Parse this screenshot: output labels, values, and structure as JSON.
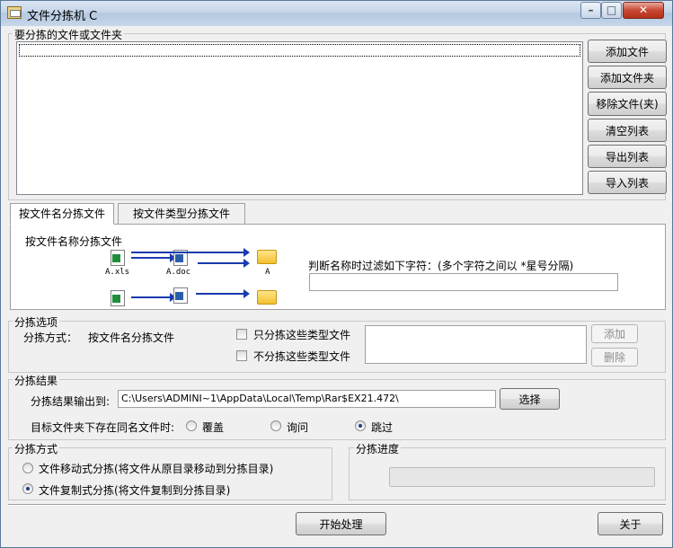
{
  "window": {
    "title": "文件分拣机 C",
    "min": "–",
    "max": "□",
    "close": "✕"
  },
  "files_group": {
    "label": "要分拣的文件或文件夹",
    "buttons": [
      "添加文件",
      "添加文件夹",
      "移除文件(夹)",
      "清空列表",
      "导出列表",
      "导入列表"
    ]
  },
  "tabs": [
    "按文件名分拣文件",
    "按文件类型分拣文件"
  ],
  "tab_panel": {
    "heading": "按文件名称分拣文件",
    "illustration": {
      "row1": [
        "A.xls",
        "A.doc",
        "A"
      ],
      "icons": [
        "excel-file-icon",
        "word-file-icon",
        "folder-icon"
      ]
    },
    "filter_label": "判断名称时过滤如下字符：(多个字符之间以 *星号分隔)",
    "filter_value": ""
  },
  "options": {
    "label": "分拣选项",
    "mode_label": "分拣方式：",
    "mode_value": "按文件名分拣文件",
    "only_types_label": "只分拣这些类型文件",
    "exclude_types_label": "不分拣这些类型文件",
    "add_button": "添加",
    "delete_button": "删除"
  },
  "result": {
    "label": "分拣结果",
    "output_label": "分拣结果输出到:",
    "output_path": "C:\\Users\\ADMINI~1\\AppData\\Local\\Temp\\Rar$EX21.472\\",
    "choose_button": "选择",
    "conflict_label": "目标文件夹下存在同名文件时:",
    "conflict_options": [
      "覆盖",
      "询问",
      "跳过"
    ],
    "conflict_selected": "跳过"
  },
  "method": {
    "label": "分拣方式",
    "options": [
      "文件移动式分拣(将文件从原目录移动到分拣目录)",
      "文件复制式分拣(将文件复制到分拣目录)"
    ],
    "selected": "文件复制式分拣(将文件复制到分拣目录)"
  },
  "progress": {
    "label": "分拣进度",
    "fraction": 0
  },
  "footer": {
    "start_button": "开始处理",
    "about_button": "关于"
  }
}
